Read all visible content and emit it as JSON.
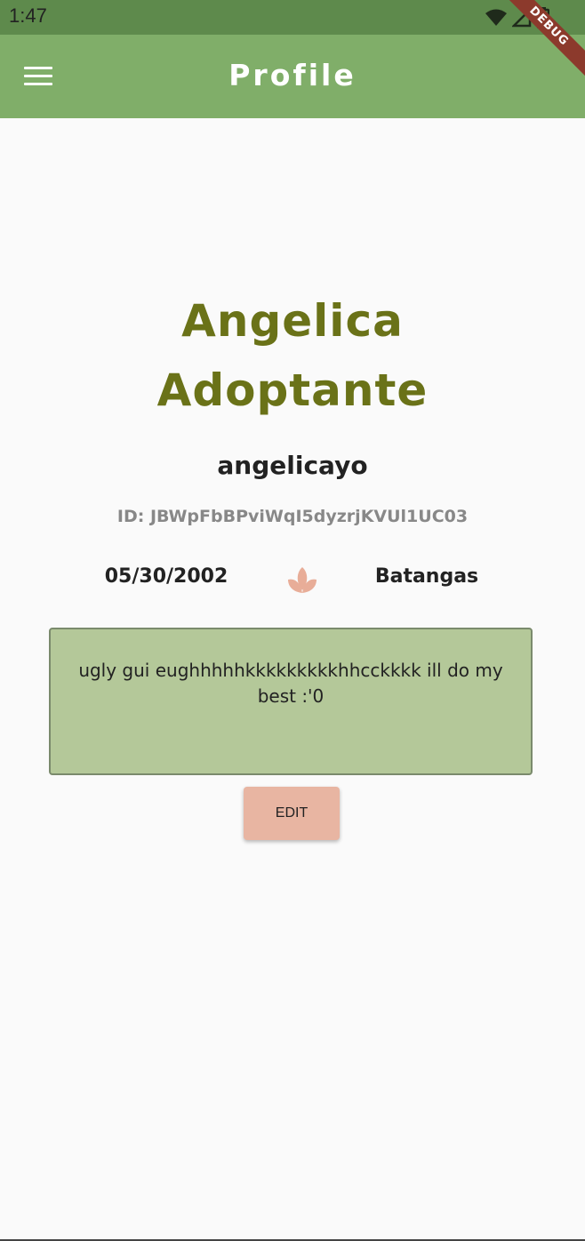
{
  "status_bar": {
    "time": "1:47",
    "icons": [
      "wifi-icon",
      "signal-icon",
      "battery-icon"
    ],
    "debug_label": "DEBUG"
  },
  "app_bar": {
    "title": "Profile",
    "menu_icon": "hamburger-menu-icon"
  },
  "profile": {
    "full_name_line1": "Angelica",
    "full_name_line2": "Adoptante",
    "username": "angelicayo",
    "user_id": "ID: JBWpFbBPviWqI5dyzrjKVUl1UC03",
    "birthdate": "05/30/2002",
    "divider_icon": "lotus-icon",
    "location": "Batangas",
    "bio": "ugly gui eughhhhhkkkkkkkkkhhcckkkk ill do my best :'0"
  },
  "actions": {
    "edit_label": "EDIT"
  },
  "colors": {
    "status_bar": "#5e8a4c",
    "app_bar": "#80ae69",
    "name": "#6a7218",
    "bio_background": "#b4c899",
    "edit_button": "#e8b5a2",
    "lotus": "#e8ad98",
    "debug_ribbon": "#8c3a2c"
  }
}
